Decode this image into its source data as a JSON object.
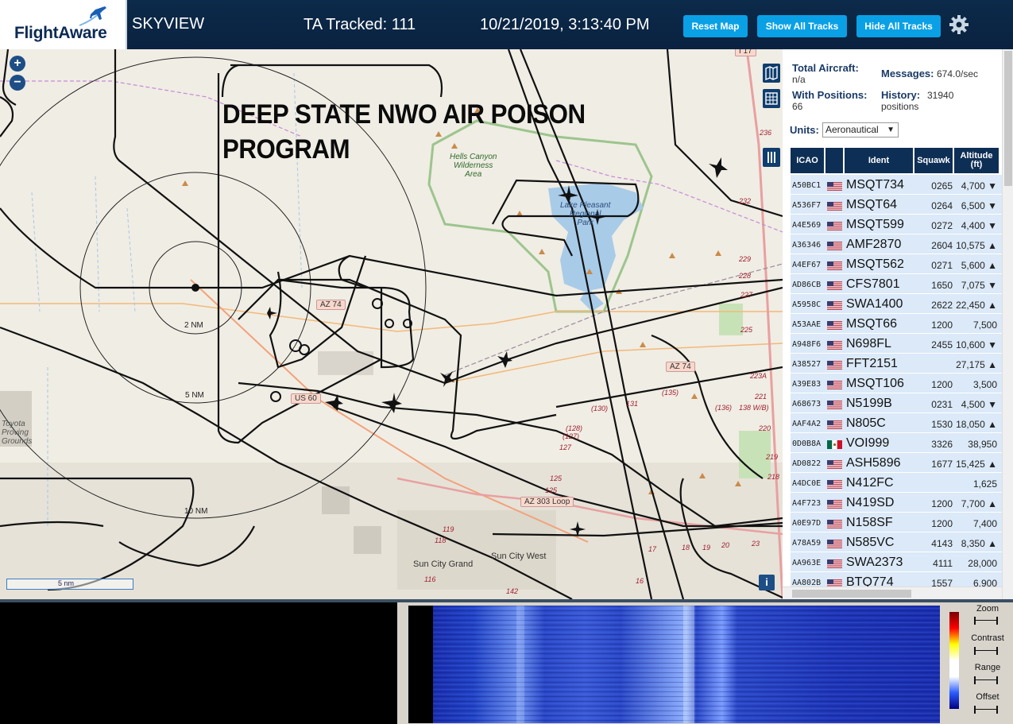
{
  "header": {
    "logo_text": "FlightAware",
    "app_name": "SKYVIEW",
    "tracked_label": "TA Tracked: 111",
    "datetime": "10/21/2019, 3:13:40 PM",
    "buttons": {
      "reset_map": "Reset Map",
      "show_all": "Show All Tracks",
      "hide_all": "Hide All Tracks"
    },
    "settings_icon": "gear-icon"
  },
  "map": {
    "overlay_title_line1": "DEEP STATE NWO AIR POISON",
    "overlay_title_line2": "PROGRAM",
    "zoom_in": "+",
    "zoom_out": "−",
    "scale_label": "5 nm",
    "info_label": "i",
    "ring_labels": [
      "2 NM",
      "5 NM",
      "10 NM"
    ],
    "places": [
      {
        "id": "hells",
        "text": "Hells Canyon\nWilderness\nArea"
      },
      {
        "id": "lake",
        "text": "Lake Pleasant\nRegional\nPark"
      },
      {
        "id": "toyota",
        "text": "Toyota\nProving\nGrounds"
      },
      {
        "id": "suncitygrand",
        "text": "Sun City Grand"
      },
      {
        "id": "suncitywest",
        "text": "Sun City West"
      }
    ],
    "shields": [
      "AZ 74",
      "AZ 74",
      "US 60",
      "AZ 303 Loop",
      "I 17"
    ],
    "route_numbers": [
      "236",
      "232",
      "229",
      "228",
      "227",
      "225",
      "223A",
      "221",
      "220",
      "219",
      "218",
      "(135)",
      "(130)",
      "(136)",
      "138 W/B)",
      "131",
      "(128)",
      "(127)",
      "127",
      "125",
      "125",
      "119",
      "118",
      "116",
      "142",
      "17",
      "18",
      "19",
      "20",
      "23",
      "16"
    ],
    "controls": [
      "map-layers-icon",
      "grid-icon",
      "columns-icon"
    ]
  },
  "sidebar": {
    "total_aircraft_label": "Total Aircraft:",
    "total_aircraft_value": "n/a",
    "messages_label": "Messages:",
    "messages_value": "674.0/sec",
    "with_positions_label": "With Positions:",
    "with_positions_value": "66",
    "history_label": "History:",
    "history_value": "31940",
    "history_unit": "positions",
    "units_label": "Units:",
    "units_value": "Aeronautical",
    "columns": [
      "ICAO",
      "",
      "Ident",
      "Squawk",
      "Altitude (ft)"
    ],
    "rows": [
      {
        "icao": "A50BC1",
        "flag": "us",
        "ident": "MSQT734",
        "squawk": "0265",
        "alt": "4,700 ▼"
      },
      {
        "icao": "A536F7",
        "flag": "us",
        "ident": "MSQT64",
        "squawk": "0264",
        "alt": "6,500 ▼"
      },
      {
        "icao": "A4E569",
        "flag": "us",
        "ident": "MSQT599",
        "squawk": "0272",
        "alt": "4,400 ▼"
      },
      {
        "icao": "A36346",
        "flag": "us",
        "ident": "AMF2870",
        "squawk": "2604",
        "alt": "10,575 ▲"
      },
      {
        "icao": "A4EF67",
        "flag": "us",
        "ident": "MSQT562",
        "squawk": "0271",
        "alt": "5,600 ▲"
      },
      {
        "icao": "AD86CB",
        "flag": "us",
        "ident": "CFS7801",
        "squawk": "1650",
        "alt": "7,075 ▼"
      },
      {
        "icao": "A5958C",
        "flag": "us",
        "ident": "SWA1400",
        "squawk": "2622",
        "alt": "22,450 ▲"
      },
      {
        "icao": "A53AAE",
        "flag": "us",
        "ident": "MSQT66",
        "squawk": "1200",
        "alt": "7,500"
      },
      {
        "icao": "A948F6",
        "flag": "us",
        "ident": "N698FL",
        "squawk": "2455",
        "alt": "10,600 ▼"
      },
      {
        "icao": "A38527",
        "flag": "us",
        "ident": "FFT2151",
        "squawk": "",
        "alt": "27,175 ▲"
      },
      {
        "icao": "A39E83",
        "flag": "us",
        "ident": "MSQT106",
        "squawk": "1200",
        "alt": "3,500"
      },
      {
        "icao": "A68673",
        "flag": "us",
        "ident": "N5199B",
        "squawk": "0231",
        "alt": "4,500 ▼"
      },
      {
        "icao": "AAF4A2",
        "flag": "us",
        "ident": "N805C",
        "squawk": "1530",
        "alt": "18,050 ▲"
      },
      {
        "icao": "0D0B8A",
        "flag": "mx",
        "ident": "VOI999",
        "squawk": "3326",
        "alt": "38,950"
      },
      {
        "icao": "AD0822",
        "flag": "us",
        "ident": "ASH5896",
        "squawk": "1677",
        "alt": "15,425 ▲"
      },
      {
        "icao": "A4DC0E",
        "flag": "us",
        "ident": "N412FC",
        "squawk": "",
        "alt": "1,625"
      },
      {
        "icao": "A4F723",
        "flag": "us",
        "ident": "N419SD",
        "squawk": "1200",
        "alt": "7,700 ▲"
      },
      {
        "icao": "A0E97D",
        "flag": "us",
        "ident": "N158SF",
        "squawk": "1200",
        "alt": "7,400"
      },
      {
        "icao": "A78A59",
        "flag": "us",
        "ident": "N585VC",
        "squawk": "4143",
        "alt": "8,350 ▲"
      },
      {
        "icao": "AA963E",
        "flag": "us",
        "ident": "SWA2373",
        "squawk": "4111",
        "alt": "28,000"
      },
      {
        "icao": "AA802B",
        "flag": "us",
        "ident": "BTQ774",
        "squawk": "1557",
        "alt": "6,900"
      }
    ]
  },
  "waterfall": {
    "controls": [
      "Zoom",
      "Contrast",
      "Range",
      "Offset"
    ]
  },
  "colors": {
    "header_bg": "#0a2240",
    "button_blue": "#0aa0e6",
    "table_header": "#0e2f55",
    "row_bg": "#dbe9f8",
    "map_bg": "#f0ede4",
    "water": "#a8cbe8"
  }
}
